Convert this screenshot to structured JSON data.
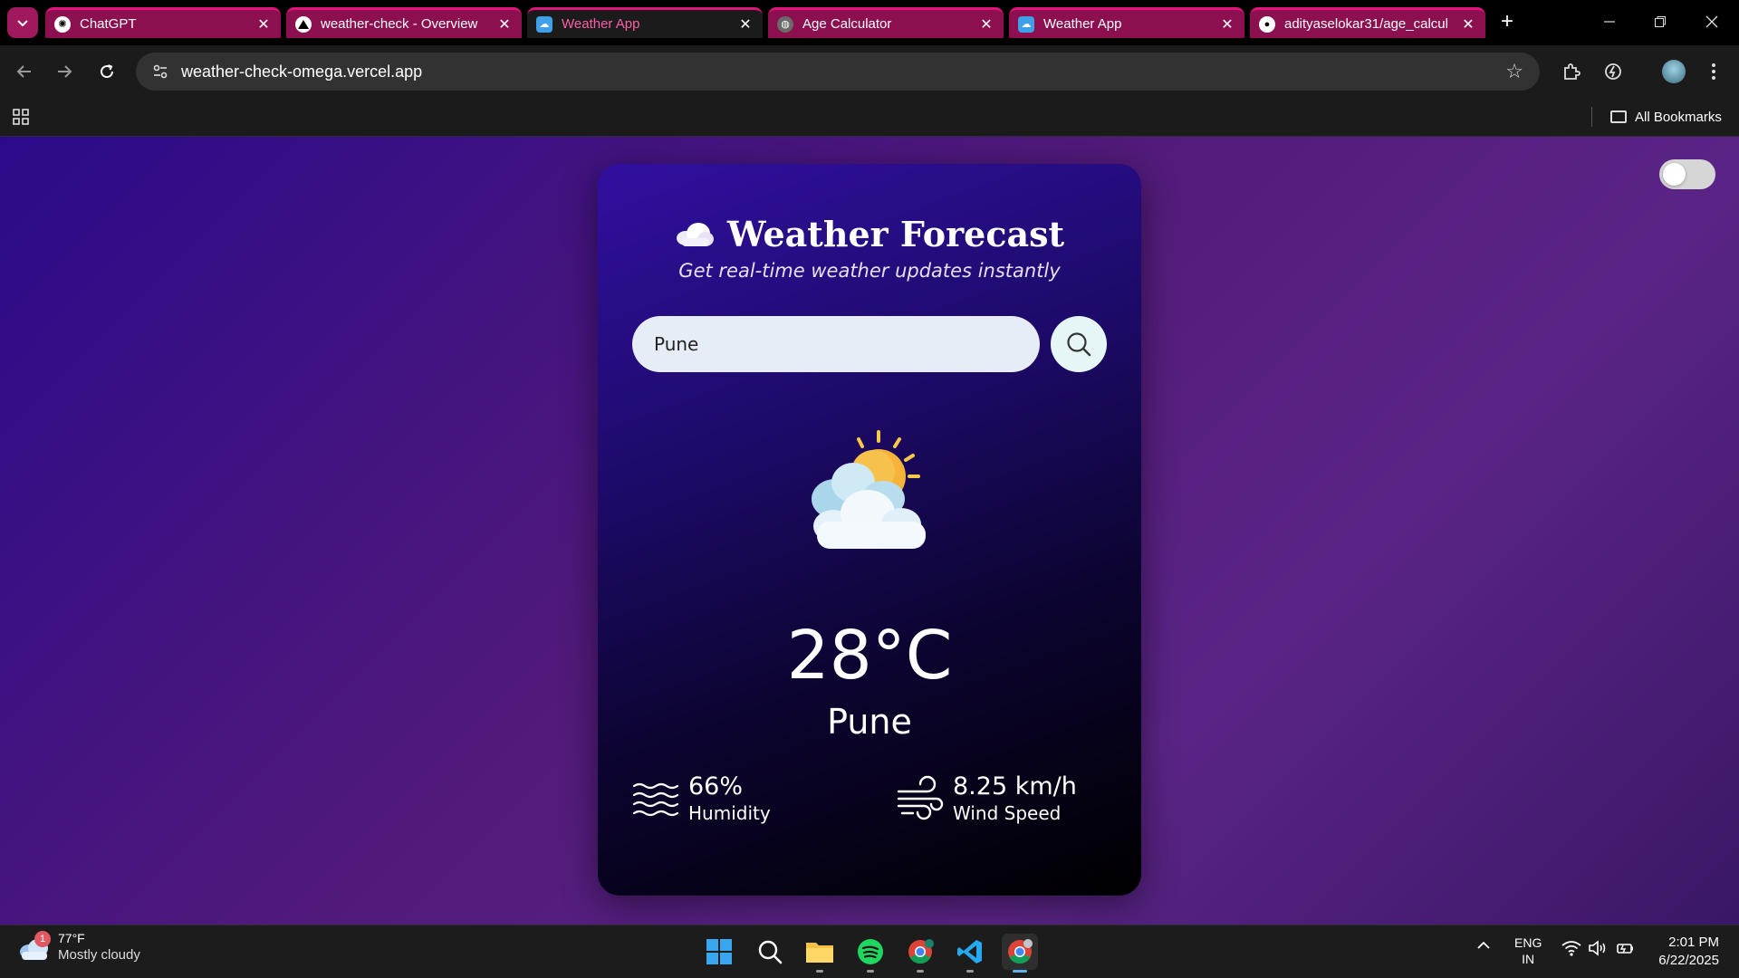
{
  "browser": {
    "tabs": [
      {
        "title": "ChatGPT",
        "favicon": "chatgpt-icon",
        "active": false
      },
      {
        "title": "weather-check - Overview",
        "favicon": "vercel-icon",
        "active": false
      },
      {
        "title": "Weather App",
        "favicon": "weather-app-icon",
        "active": true
      },
      {
        "title": "Age Calculator",
        "favicon": "globe-icon",
        "active": false
      },
      {
        "title": "Weather App",
        "favicon": "weather-app-icon",
        "active": false
      },
      {
        "title": "adityaselokar31/age_calcul",
        "favicon": "github-icon",
        "active": false
      }
    ],
    "url": "weather-check-omega.vercel.app",
    "bookmarks_label": "All Bookmarks",
    "accent_color": "#e0147a"
  },
  "app": {
    "title": "Weather Forecast",
    "subtitle": "Get real-time weather updates instantly",
    "search": {
      "value": "Pune",
      "placeholder": ""
    },
    "weather_icon": "partly-cloudy-sun-icon",
    "temperature": "28°C",
    "city": "Pune",
    "humidity": {
      "value": "66%",
      "label": "Humidity"
    },
    "wind": {
      "value": "8.25 km/h",
      "label": "Wind Speed"
    },
    "theme_toggle_on": false
  },
  "taskbar": {
    "weather": {
      "temp": "77°F",
      "condition": "Mostly cloudy",
      "badge": "1"
    },
    "language": {
      "line1": "ENG",
      "line2": "IN"
    },
    "time": "2:01 PM",
    "date": "6/22/2025"
  }
}
